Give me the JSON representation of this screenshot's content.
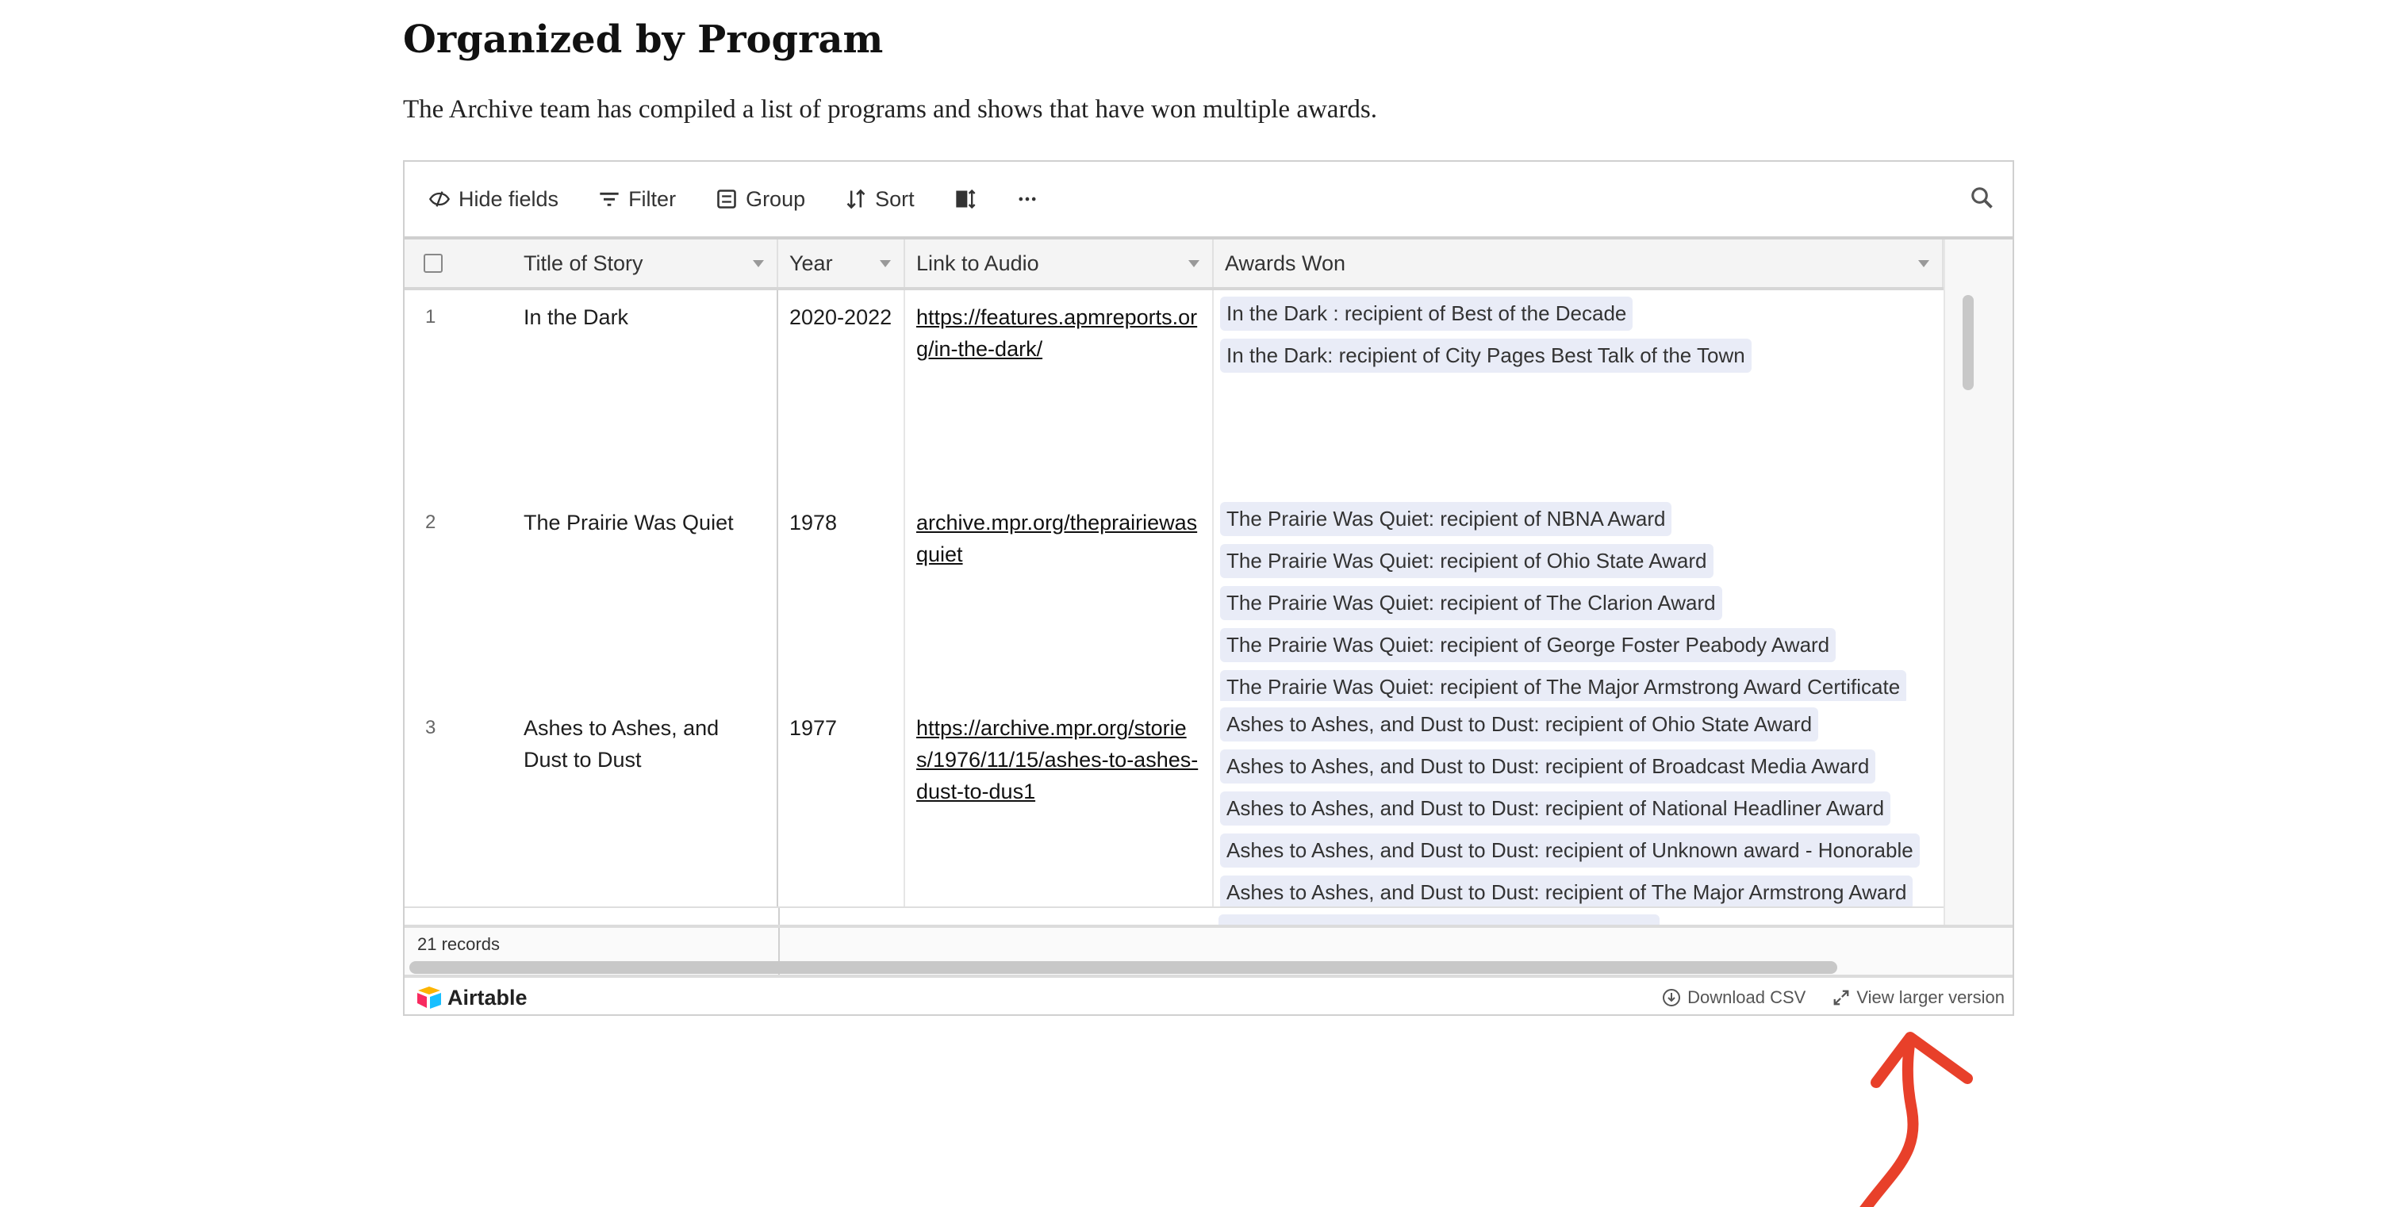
{
  "page": {
    "title": "Organized by Program",
    "intro": "The Archive team has compiled a list of programs and shows that have won multiple awards."
  },
  "toolbar": {
    "hide_fields": "Hide fields",
    "filter": "Filter",
    "group": "Group",
    "sort": "Sort"
  },
  "columns": [
    "Title of Story",
    "Year",
    "Link to Audio",
    "Awards Won"
  ],
  "rows": [
    {
      "num": "1",
      "title": "In the Dark",
      "year": "2020-2022",
      "link": "https://features.apmreports.org/in-the-dark/",
      "awards": [
        "In the Dark : recipient of Best of the Decade",
        "In the Dark: recipient of City Pages Best Talk of the Town"
      ]
    },
    {
      "num": "2",
      "title": "The Prairie Was Quiet",
      "year": "1978",
      "link": "archive.mpr.org/theprairiewasquiet",
      "awards": [
        "The Prairie Was Quiet: recipient of NBNA Award",
        "The Prairie Was Quiet: recipient of Ohio State Award",
        "The Prairie Was Quiet: recipient of The Clarion Award",
        "The Prairie Was Quiet: recipient of George Foster Peabody Award",
        "The Prairie Was Quiet: recipient of The Major Armstrong Award Certificate"
      ]
    },
    {
      "num": "3",
      "title": "Ashes to Ashes, and Dust to Dust",
      "year": "1977",
      "link": "https://archive.mpr.org/stories/1976/11/15/ashes-to-ashes-dust-to-dus1",
      "awards": [
        "Ashes to Ashes, and Dust to Dust: recipient of Ohio State Award",
        "Ashes to Ashes, and Dust to Dust: recipient of Broadcast Media Award",
        "Ashes to Ashes, and Dust to Dust: recipient of National Headliner Award",
        "Ashes to Ashes, and Dust to Dust: recipient of Unknown award - Honorable",
        "Ashes to Ashes, and Dust to Dust: recipient of The Major Armstrong Award"
      ]
    }
  ],
  "footer": {
    "records": "21 records",
    "brand": "Airtable",
    "download": "Download CSV",
    "view_larger": "View larger version"
  },
  "colors": {
    "pill": "#e9ecf7",
    "annotation_arrow": "#e8402a"
  }
}
